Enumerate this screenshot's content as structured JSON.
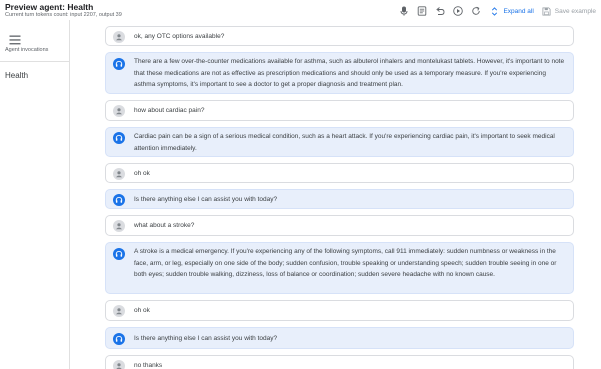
{
  "header": {
    "title": "Preview agent: Health",
    "subtitle": "Current turn tokens count: input 2207, output 39"
  },
  "toolbar": {
    "icons": [
      "microphone-icon",
      "notes-icon",
      "undo-icon",
      "play-icon",
      "reset-icon",
      "expand-icon",
      "save-icon"
    ],
    "expand_label": "Expand all",
    "save_label": "Save example"
  },
  "sidebar": {
    "menu_label": "Agent invocations",
    "agent": "Health"
  },
  "colors": {
    "accent": "#1a73e8",
    "agent_bubble": "#e8effb",
    "user_avatar": "#dadce0"
  },
  "conversation": [
    {
      "role": "user",
      "text": "ok, any OTC options available?"
    },
    {
      "role": "agent",
      "text": "There are a few over-the-counter medications available for asthma, such as albuterol inhalers and montelukast tablets. However, it's important to note that these medications are not as effective as prescription medications and should only be used as a temporary measure. If you're experiencing asthma symptoms, it's important to see a doctor to get a proper diagnosis and treatment plan."
    },
    {
      "role": "user",
      "text": "how about cardiac pain?"
    },
    {
      "role": "agent",
      "text": "Cardiac pain can be a sign of a serious medical condition, such as a heart attack. If you're experiencing cardiac pain, it's important to seek medical attention immediately."
    },
    {
      "role": "user",
      "text": "oh ok"
    },
    {
      "role": "agent",
      "text": "Is there anything else I can assist you with today?"
    },
    {
      "role": "user",
      "text": "what about a stroke?"
    },
    {
      "role": "agent",
      "text": "A stroke is a medical emergency. If you're experiencing any of the following symptoms, call 911 immediately: sudden numbness or weakness in the face, arm, or leg, especially on one side of the body; sudden confusion, trouble speaking or understanding speech; sudden trouble seeing in one or both eyes; sudden trouble walking, dizziness, loss of balance or coordination; sudden severe headache with no known cause."
    },
    {
      "role": "user",
      "text": "oh ok"
    },
    {
      "role": "agent",
      "text": "Is there anything else I can assist you with today?"
    },
    {
      "role": "user",
      "text": "no thanks"
    }
  ]
}
